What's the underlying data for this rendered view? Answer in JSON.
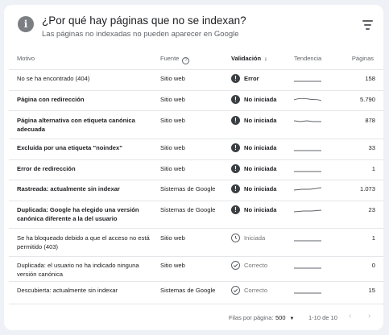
{
  "header": {
    "title": "¿Por qué hay páginas que no se indexan?",
    "subtitle": "Las páginas no indexadas no pueden aparecer en Google"
  },
  "columns": {
    "reason": "Motivo",
    "source": "Fuente",
    "validation": "Validación",
    "trend": "Tendencia",
    "pages": "Páginas"
  },
  "rows": [
    {
      "reason": "No se ha encontrado (404)",
      "source": "Sitio web",
      "status": "Error",
      "status_kind": "error",
      "pages": "158"
    },
    {
      "reason": "Página con redirección",
      "source": "Sitio web",
      "status": "No iniciada",
      "status_kind": "error",
      "pages": "5.790"
    },
    {
      "reason": "Página alternativa con etiqueta canónica adecuada",
      "source": "Sitio web",
      "status": "No iniciada",
      "status_kind": "error",
      "pages": "878"
    },
    {
      "reason": "Excluida por una etiqueta \"noindex\"",
      "source": "Sitio web",
      "status": "No iniciada",
      "status_kind": "error",
      "pages": "33"
    },
    {
      "reason": "Error de redirección",
      "source": "Sitio web",
      "status": "No iniciada",
      "status_kind": "error",
      "pages": "1"
    },
    {
      "reason": "Rastreada: actualmente sin indexar",
      "source": "Sistemas de Google",
      "status": "No iniciada",
      "status_kind": "error",
      "pages": "1.073"
    },
    {
      "reason": "Duplicada: Google ha elegido una versión canónica diferente a la del usuario",
      "source": "Sistemas de Google",
      "status": "No iniciada",
      "status_kind": "error",
      "pages": "23"
    },
    {
      "reason": "Se ha bloqueado debido a que el acceso no está permitido (403)",
      "source": "Sitio web",
      "status": "Iniciada",
      "status_kind": "started",
      "pages": "1"
    },
    {
      "reason": "Duplicada: el usuario no ha indicado ninguna versión canónica",
      "source": "Sitio web",
      "status": "Correcto",
      "status_kind": "ok",
      "pages": "0"
    },
    {
      "reason": "Descubierta: actualmente sin indexar",
      "source": "Sistemas de Google",
      "status": "Correcto",
      "status_kind": "ok",
      "pages": "15"
    }
  ],
  "footer": {
    "rows_per_page_label": "Filas por página:",
    "rows_per_page_value": "500",
    "range": "1-10 de 10"
  }
}
